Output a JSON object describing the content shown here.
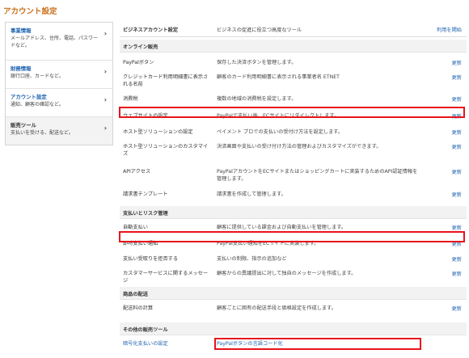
{
  "page": {
    "title": "アカウント設定"
  },
  "sidebar": {
    "items": [
      {
        "title": "事業情報",
        "desc": "メールアドレス、住所、電話、パスワードなど。"
      },
      {
        "title": "財務情報",
        "desc": "銀行口座、カードなど。"
      },
      {
        "title": "アカウント設定",
        "desc": "通知、顧客の確認など。"
      },
      {
        "title": "販売ツール",
        "desc": "支払いを受ける、配送など。"
      }
    ]
  },
  "business_account": {
    "name": "ビジネスアカウント設定",
    "desc": "ビジネスの促進に役立つ高度なツール",
    "link": "利用を開始"
  },
  "online_sales": {
    "heading": "オンライン販売",
    "rows": [
      {
        "name": "PayPalボタン",
        "desc": "保存した決済ボタンを管理します。",
        "link": "更新"
      },
      {
        "name": "クレジットカード利用明細書に表示される名前",
        "desc": "顧客のカード利用明細書に表示される事業者名 ETNET",
        "link": "更新"
      },
      {
        "name": "消費税",
        "desc": "複数の地域の消費税を設定します。",
        "link": "更新"
      },
      {
        "name": "ウェブサイトの設定",
        "desc": "PayPalで支払い後、ECサイトにリダイレクトします。",
        "link": "更新"
      },
      {
        "name": "ホスト型ソリューションの設定",
        "desc": "ペイメント プロでの支払いの受付け方法を設定します。",
        "link": "更新"
      },
      {
        "name": "ホスト型ソリューションのカスタマイズ",
        "desc": "決済画面や支払いの受け付け方法の管理およびカスタマイズができます。",
        "link": "更新"
      },
      {
        "name": "APIアクセス",
        "desc": "PayPalアカウントをECサイトまたはショッピングカートに実装するためのAPI認証情報を管理します。",
        "link": "更新"
      },
      {
        "name": "請求書テンプレート",
        "desc": "請求書を作成して管理します。",
        "link": "更新"
      }
    ]
  },
  "payments_risk": {
    "heading": "支払いとリスク管理",
    "rows": [
      {
        "name": "自動支払い",
        "desc": "顧客に提供している課金および自動支払いを管理します。",
        "link": "更新"
      },
      {
        "name": "即時支払い通知",
        "desc": "PayPal支払い通知をECサイトに実装します。",
        "link": "更新"
      },
      {
        "name": "支払い受取りを拒否する",
        "desc": "支払いの制限、指示の追加など",
        "link": "更新"
      },
      {
        "name": "カスタマーサービスに関するメッセージ",
        "desc": "顧客からの異議提出に対して独自のメッセージを作成します。",
        "link": "更新"
      }
    ]
  },
  "shipping": {
    "heading": "商品の配送",
    "rows": [
      {
        "name": "配送料の計算",
        "desc": "顧客ごとに固有の配送手段と価格設定を作成します。",
        "link": "更新"
      }
    ]
  },
  "other_tools": {
    "heading": "その他の販売ツール",
    "rows": [
      {
        "name": "暗号化支払いの設定",
        "link_text": "PayPalボタンの言語コード化"
      }
    ]
  }
}
